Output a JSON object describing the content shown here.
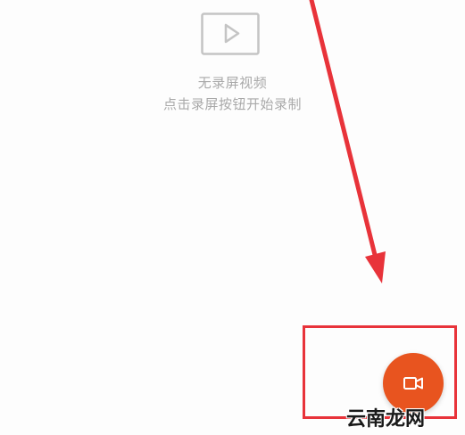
{
  "empty_state": {
    "icon": "video-play-icon",
    "title": "无录屏视频",
    "hint": "点击录屏按钮开始录制"
  },
  "record_button": {
    "icon": "video-camera-icon",
    "color": "#e8541f"
  },
  "annotation": {
    "arrow_color": "#e8333a",
    "box_color": "#e8333a"
  },
  "watermark": {
    "text": "云南龙网"
  }
}
